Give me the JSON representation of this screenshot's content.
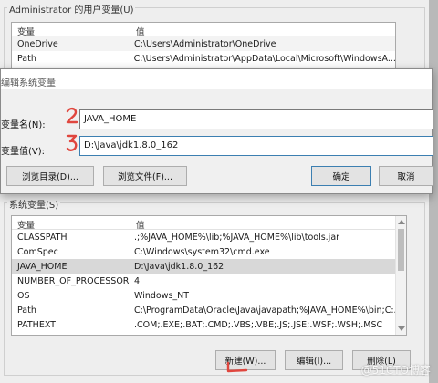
{
  "user_vars": {
    "group_title": "Administrator 的用户变量(U)",
    "headers": [
      "变量",
      "值"
    ],
    "rows": [
      {
        "name": "OneDrive",
        "value": "C:\\Users\\Administrator\\OneDrive"
      },
      {
        "name": "Path",
        "value": "C:\\Users\\Administrator\\AppData\\Local\\Microsoft\\WindowsA..."
      }
    ]
  },
  "edit_dialog": {
    "title": "编辑系统变量",
    "name_label": "变量名(N):",
    "name_value": "JAVA_HOME",
    "value_label": "变量值(V):",
    "value_value": "D:\\Java\\jdk1.8.0_162",
    "browse_dir_label": "浏览目录(D)...",
    "browse_file_label": "浏览文件(F)...",
    "ok_label": "确定",
    "cancel_label": "取消"
  },
  "system_vars": {
    "group_title": "系统变量(S)",
    "headers": [
      "变量",
      "值"
    ],
    "rows": [
      {
        "name": "CLASSPATH",
        "value": ".;%JAVA_HOME%\\lib;%JAVA_HOME%\\lib\\tools.jar"
      },
      {
        "name": "ComSpec",
        "value": "C:\\Windows\\system32\\cmd.exe"
      },
      {
        "name": "JAVA_HOME",
        "value": "D:\\Java\\jdk1.8.0_162"
      },
      {
        "name": "NUMBER_OF_PROCESSORS",
        "value": "4"
      },
      {
        "name": "OS",
        "value": "Windows_NT"
      },
      {
        "name": "Path",
        "value": "C:\\ProgramData\\Oracle\\Java\\javapath;%JAVA_HOME%\\bin;C:..."
      },
      {
        "name": "PATHEXT",
        "value": ".COM;.EXE;.BAT;.CMD;.VBS;.VBE;.JS;.JSE;.WSF;.WSH;.MSC"
      }
    ],
    "selected_index": 2,
    "new_label": "新建(W)...",
    "edit_label": "编辑(I)...",
    "delete_label": "删除(L)"
  },
  "annotations": {
    "step2": "2",
    "step3": "3"
  },
  "watermark": "@51CTO博客",
  "colors": {
    "annotation_red": "#e0463e",
    "selection": "#d8d8d8",
    "primary_border": "#3c7fb1"
  }
}
